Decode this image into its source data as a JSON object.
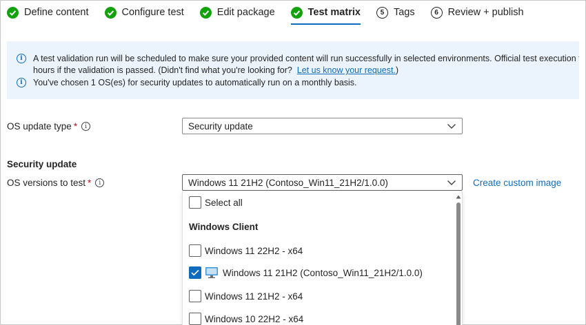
{
  "steps": [
    {
      "label": "Define content",
      "state": "done",
      "icon": "checkmark-circle-icon"
    },
    {
      "label": "Configure test",
      "state": "done",
      "icon": "checkmark-circle-icon"
    },
    {
      "label": "Edit package",
      "state": "done",
      "icon": "checkmark-circle-icon"
    },
    {
      "label": "Test matrix",
      "state": "active",
      "icon": "checkmark-circle-icon"
    },
    {
      "label": "Tags",
      "state": "pending",
      "number": "5"
    },
    {
      "label": "Review + publish",
      "state": "pending",
      "number": "6"
    }
  ],
  "banner": {
    "line1": "A test validation run will be scheduled to make sure your provided content will run successfully in selected environments. Official test execution for",
    "line2_text": "hours if the validation is passed. (Didn't find what you're looking for?",
    "line2_link": "Let us know your request.",
    "line2_end": ")",
    "line3": "You've chosen 1 OS(es) for security updates to automatically run on a monthly basis."
  },
  "os_update_type": {
    "label": "OS update type",
    "required_mark": "*",
    "value": "Security update"
  },
  "security_update": {
    "section_title": "Security update",
    "os_versions_label": "OS versions to test",
    "required_mark": "*",
    "selected_value": "Windows 11 21H2 (Contoso_Win11_21H2/1.0.0)",
    "create_link": "Create custom image",
    "select_all": "Select all",
    "group_header": "Windows Client",
    "options": [
      {
        "label": "Windows 11 22H2 - x64",
        "checked": false,
        "icon": null
      },
      {
        "label": "Windows 11 21H2 (Contoso_Win11_21H2/1.0.0)",
        "checked": true,
        "icon": "monitor-icon"
      },
      {
        "label": "Windows 11 21H2 - x64",
        "checked": false,
        "icon": null
      },
      {
        "label": "Windows 10 22H2 - x64",
        "checked": false,
        "icon": null
      }
    ]
  },
  "colors": {
    "accent": "#0f6cbd",
    "success": "#13a10e",
    "banner_bg": "#ebf3fc",
    "required": "#c50f1f"
  }
}
